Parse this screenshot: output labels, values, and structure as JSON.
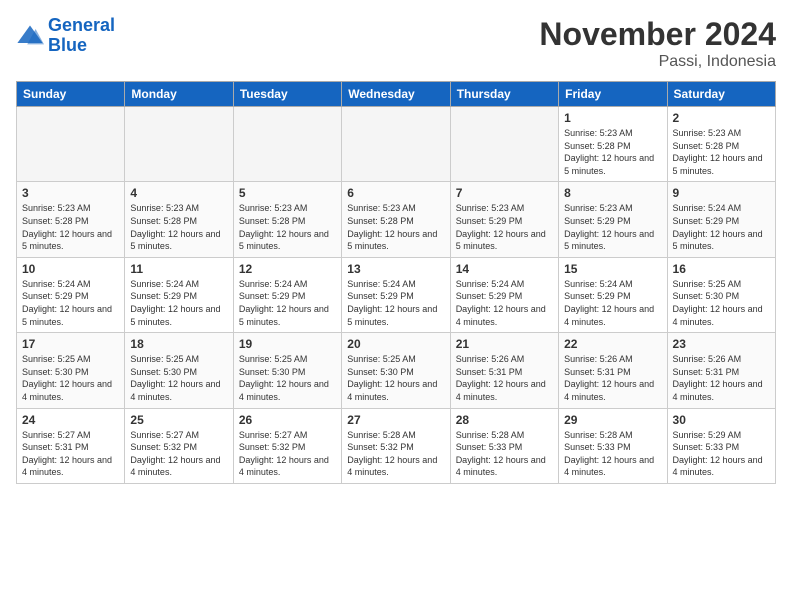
{
  "header": {
    "logo_line1": "General",
    "logo_line2": "Blue",
    "month_title": "November 2024",
    "location": "Passi, Indonesia"
  },
  "weekdays": [
    "Sunday",
    "Monday",
    "Tuesday",
    "Wednesday",
    "Thursday",
    "Friday",
    "Saturday"
  ],
  "weeks": [
    [
      {
        "day": "",
        "info": ""
      },
      {
        "day": "",
        "info": ""
      },
      {
        "day": "",
        "info": ""
      },
      {
        "day": "",
        "info": ""
      },
      {
        "day": "",
        "info": ""
      },
      {
        "day": "1",
        "info": "Sunrise: 5:23 AM\nSunset: 5:28 PM\nDaylight: 12 hours and 5 minutes."
      },
      {
        "day": "2",
        "info": "Sunrise: 5:23 AM\nSunset: 5:28 PM\nDaylight: 12 hours and 5 minutes."
      }
    ],
    [
      {
        "day": "3",
        "info": "Sunrise: 5:23 AM\nSunset: 5:28 PM\nDaylight: 12 hours and 5 minutes."
      },
      {
        "day": "4",
        "info": "Sunrise: 5:23 AM\nSunset: 5:28 PM\nDaylight: 12 hours and 5 minutes."
      },
      {
        "day": "5",
        "info": "Sunrise: 5:23 AM\nSunset: 5:28 PM\nDaylight: 12 hours and 5 minutes."
      },
      {
        "day": "6",
        "info": "Sunrise: 5:23 AM\nSunset: 5:28 PM\nDaylight: 12 hours and 5 minutes."
      },
      {
        "day": "7",
        "info": "Sunrise: 5:23 AM\nSunset: 5:29 PM\nDaylight: 12 hours and 5 minutes."
      },
      {
        "day": "8",
        "info": "Sunrise: 5:23 AM\nSunset: 5:29 PM\nDaylight: 12 hours and 5 minutes."
      },
      {
        "day": "9",
        "info": "Sunrise: 5:24 AM\nSunset: 5:29 PM\nDaylight: 12 hours and 5 minutes."
      }
    ],
    [
      {
        "day": "10",
        "info": "Sunrise: 5:24 AM\nSunset: 5:29 PM\nDaylight: 12 hours and 5 minutes."
      },
      {
        "day": "11",
        "info": "Sunrise: 5:24 AM\nSunset: 5:29 PM\nDaylight: 12 hours and 5 minutes."
      },
      {
        "day": "12",
        "info": "Sunrise: 5:24 AM\nSunset: 5:29 PM\nDaylight: 12 hours and 5 minutes."
      },
      {
        "day": "13",
        "info": "Sunrise: 5:24 AM\nSunset: 5:29 PM\nDaylight: 12 hours and 5 minutes."
      },
      {
        "day": "14",
        "info": "Sunrise: 5:24 AM\nSunset: 5:29 PM\nDaylight: 12 hours and 4 minutes."
      },
      {
        "day": "15",
        "info": "Sunrise: 5:24 AM\nSunset: 5:29 PM\nDaylight: 12 hours and 4 minutes."
      },
      {
        "day": "16",
        "info": "Sunrise: 5:25 AM\nSunset: 5:30 PM\nDaylight: 12 hours and 4 minutes."
      }
    ],
    [
      {
        "day": "17",
        "info": "Sunrise: 5:25 AM\nSunset: 5:30 PM\nDaylight: 12 hours and 4 minutes."
      },
      {
        "day": "18",
        "info": "Sunrise: 5:25 AM\nSunset: 5:30 PM\nDaylight: 12 hours and 4 minutes."
      },
      {
        "day": "19",
        "info": "Sunrise: 5:25 AM\nSunset: 5:30 PM\nDaylight: 12 hours and 4 minutes."
      },
      {
        "day": "20",
        "info": "Sunrise: 5:25 AM\nSunset: 5:30 PM\nDaylight: 12 hours and 4 minutes."
      },
      {
        "day": "21",
        "info": "Sunrise: 5:26 AM\nSunset: 5:31 PM\nDaylight: 12 hours and 4 minutes."
      },
      {
        "day": "22",
        "info": "Sunrise: 5:26 AM\nSunset: 5:31 PM\nDaylight: 12 hours and 4 minutes."
      },
      {
        "day": "23",
        "info": "Sunrise: 5:26 AM\nSunset: 5:31 PM\nDaylight: 12 hours and 4 minutes."
      }
    ],
    [
      {
        "day": "24",
        "info": "Sunrise: 5:27 AM\nSunset: 5:31 PM\nDaylight: 12 hours and 4 minutes."
      },
      {
        "day": "25",
        "info": "Sunrise: 5:27 AM\nSunset: 5:32 PM\nDaylight: 12 hours and 4 minutes."
      },
      {
        "day": "26",
        "info": "Sunrise: 5:27 AM\nSunset: 5:32 PM\nDaylight: 12 hours and 4 minutes."
      },
      {
        "day": "27",
        "info": "Sunrise: 5:28 AM\nSunset: 5:32 PM\nDaylight: 12 hours and 4 minutes."
      },
      {
        "day": "28",
        "info": "Sunrise: 5:28 AM\nSunset: 5:33 PM\nDaylight: 12 hours and 4 minutes."
      },
      {
        "day": "29",
        "info": "Sunrise: 5:28 AM\nSunset: 5:33 PM\nDaylight: 12 hours and 4 minutes."
      },
      {
        "day": "30",
        "info": "Sunrise: 5:29 AM\nSunset: 5:33 PM\nDaylight: 12 hours and 4 minutes."
      }
    ]
  ]
}
